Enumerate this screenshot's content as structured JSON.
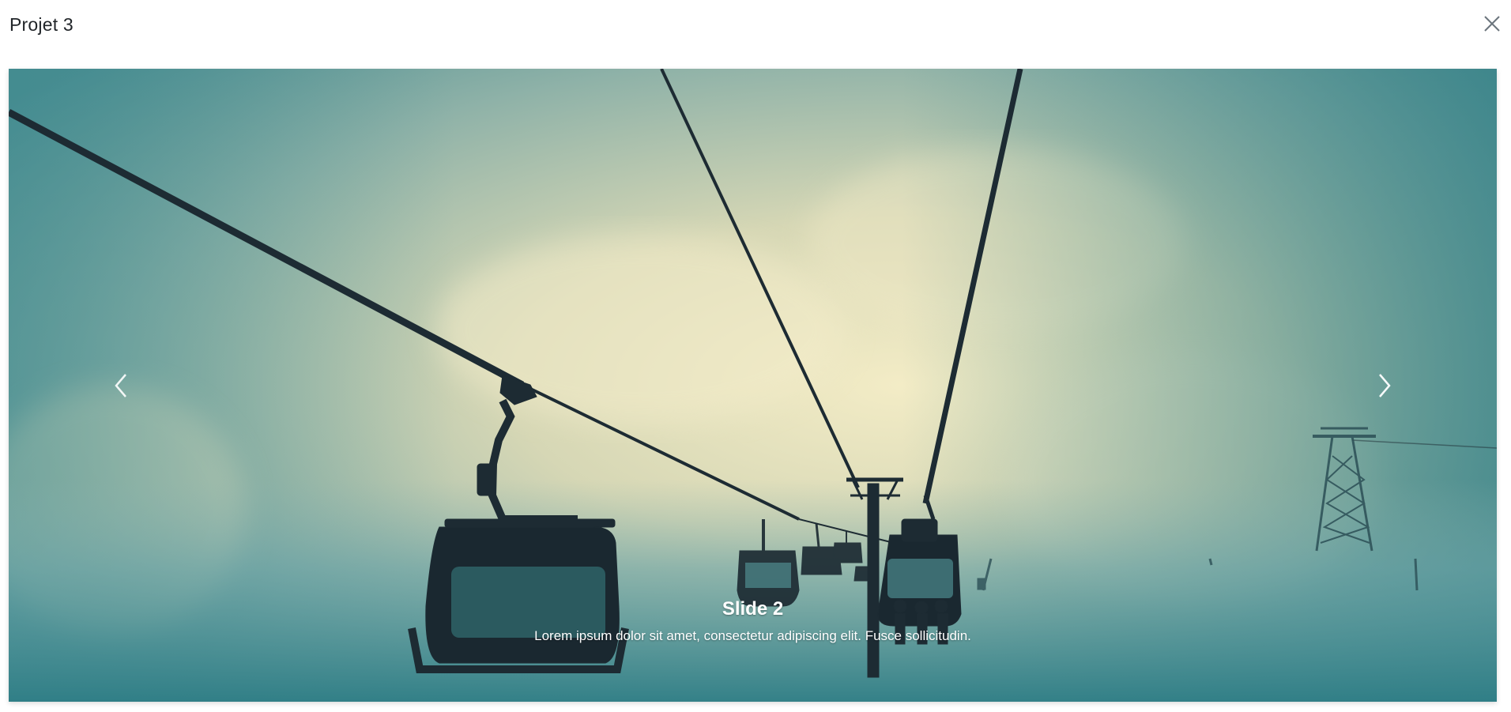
{
  "modal": {
    "title": "Projet 3",
    "close_icon": "close-icon"
  },
  "carousel": {
    "active_index": 2,
    "image_subject": "chairlift-foggy-mountain-photo",
    "prev_icon": "chevron-left-icon",
    "next_icon": "chevron-right-icon",
    "caption": {
      "title": "Slide 2",
      "text": "Lorem ipsum dolor sit amet, consectetur adipiscing elit. Fusce sollicitudin."
    }
  },
  "colors": {
    "sky_light": "#efe8c0",
    "sky_mid": "#9fb9a6",
    "sky_dark": "#2f7e86",
    "silhouette": "#1d2b33"
  }
}
